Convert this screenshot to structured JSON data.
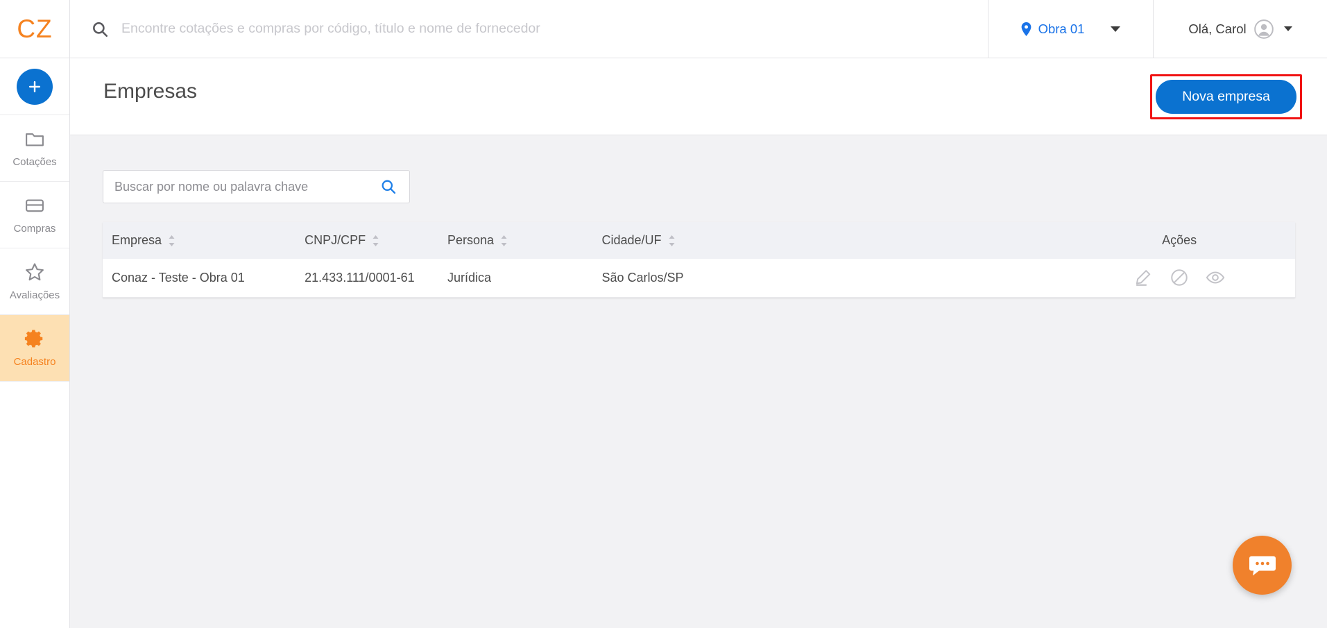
{
  "brand": {
    "logo_text": "CZ",
    "accent_orange": "#f5821f",
    "accent_blue": "#0b72d0",
    "highlight_red": "#f01313",
    "chat_orange": "#f0812c"
  },
  "topbar": {
    "search": {
      "placeholder": "Encontre cotações e compras por código, título e nome de fornecedor",
      "value": "",
      "icon": "search-icon"
    },
    "project_selector": {
      "label": "Obra 01",
      "icon": "location-pin-icon",
      "caret": "chevron-down-icon"
    },
    "user_menu": {
      "label": "Olá, Carol",
      "icon": "avatar-icon",
      "caret": "chevron-down-icon"
    }
  },
  "sidebar": {
    "add_button": {
      "label": "+",
      "icon": "plus-icon"
    },
    "items": [
      {
        "label": "Cotações",
        "icon": "folder-icon",
        "active": false
      },
      {
        "label": "Compras",
        "icon": "card-icon",
        "active": false
      },
      {
        "label": "Avaliações",
        "icon": "star-icon",
        "active": false
      },
      {
        "label": "Cadastro",
        "icon": "gear-icon",
        "active": true
      }
    ]
  },
  "page": {
    "title": "Empresas",
    "primary_action": {
      "label": "Nova empresa",
      "highlighted": true
    }
  },
  "filters": {
    "search": {
      "placeholder": "Buscar por nome ou palavra chave",
      "value": "",
      "icon": "search-icon"
    }
  },
  "table": {
    "columns": [
      {
        "label": "Empresa",
        "sortable": true
      },
      {
        "label": "CNPJ/CPF",
        "sortable": true
      },
      {
        "label": "Persona",
        "sortable": true
      },
      {
        "label": "Cidade/UF",
        "sortable": true
      },
      {
        "label": "Ações",
        "sortable": false
      }
    ],
    "rows": [
      {
        "empresa": "Conaz - Teste - Obra 01",
        "cnpj_cpf": "21.433.111/0001-61",
        "persona": "Jurídica",
        "cidade_uf": "São Carlos/SP",
        "actions": [
          "edit-icon",
          "block-icon",
          "view-icon"
        ]
      }
    ]
  },
  "chat_widget": {
    "icon": "chat-bubble-icon",
    "label": ""
  }
}
